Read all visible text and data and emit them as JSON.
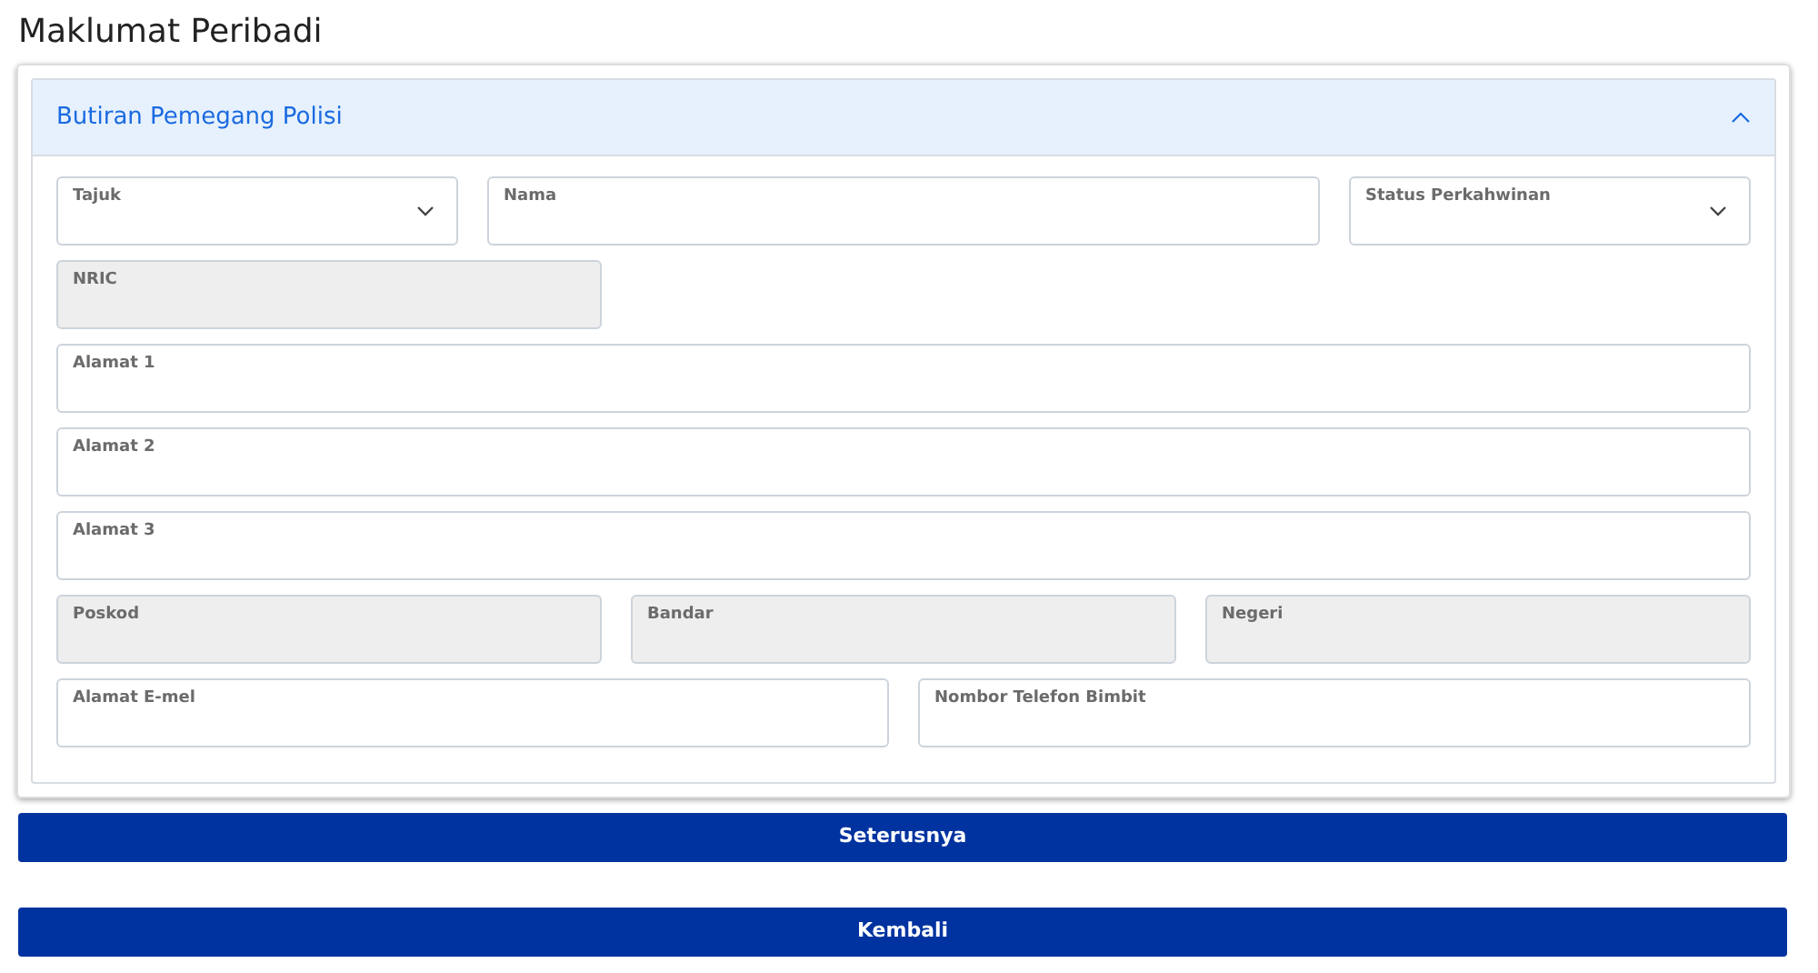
{
  "page_title": "Maklumat Peribadi",
  "section": {
    "title": "Butiran Pemegang Polisi",
    "expanded": true,
    "rows": [
      [
        {
          "label": "Tajuk",
          "kind": "select",
          "disabled": false
        },
        {
          "label": "Nama",
          "kind": "text",
          "disabled": false
        },
        {
          "label": "Status Perkahwinan",
          "kind": "select",
          "disabled": false
        }
      ],
      [
        {
          "label": "NRIC",
          "kind": "text",
          "disabled": true
        }
      ],
      [
        {
          "label": "Alamat 1",
          "kind": "text",
          "disabled": false
        }
      ],
      [
        {
          "label": "Alamat 2",
          "kind": "text",
          "disabled": false
        }
      ],
      [
        {
          "label": "Alamat 3",
          "kind": "text",
          "disabled": false
        }
      ],
      [
        {
          "label": "Poskod",
          "kind": "text",
          "disabled": true
        },
        {
          "label": "Bandar",
          "kind": "text",
          "disabled": true
        },
        {
          "label": "Negeri",
          "kind": "text",
          "disabled": true
        }
      ],
      [
        {
          "label": "Alamat E-mel",
          "kind": "text",
          "disabled": false
        },
        {
          "label": "Nombor Telefon Bimbit",
          "kind": "text",
          "disabled": false
        }
      ]
    ]
  },
  "buttons": [
    "Seterusnya",
    "Kembali"
  ]
}
